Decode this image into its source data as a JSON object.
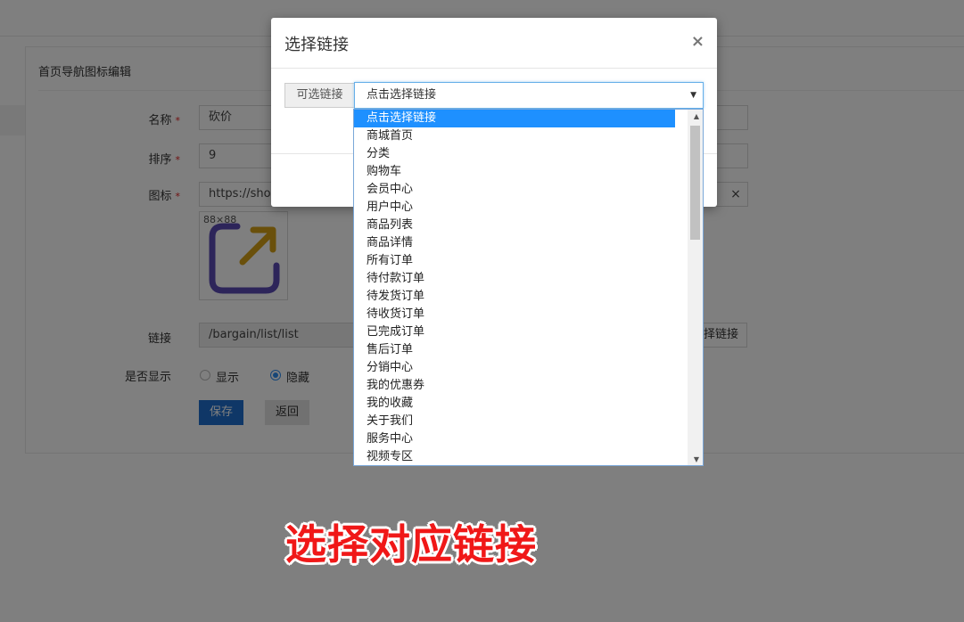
{
  "page": {
    "panel_title": "首页导航图标编辑",
    "fields": {
      "name_label": "名称",
      "name_value": "砍价",
      "sort_label": "排序",
      "sort_value": "9",
      "icon_label": "图标",
      "icon_value": "https://shop",
      "icon_clear": "×",
      "preview_size": "88×88",
      "link_label": "链接",
      "link_value": "/bargain/list/list",
      "link_button": "择链接",
      "show_label": "是否显示",
      "show_option": "显示",
      "hide_option": "隐藏",
      "required_mark": "*"
    },
    "buttons": {
      "save": "保存",
      "back": "返回"
    }
  },
  "modal": {
    "title": "选择链接",
    "close": "×",
    "addon_label": "可选链接",
    "select_value": "点击选择链接",
    "options": [
      "点击选择链接",
      "商城首页",
      "分类",
      "购物车",
      "会员中心",
      "用户中心",
      "商品列表",
      "商品详情",
      "所有订单",
      "待付款订单",
      "待发货订单",
      "待收货订单",
      "已完成订单",
      "售后订单",
      "分销中心",
      "我的优惠券",
      "我的收藏",
      "关于我们",
      "服务中心",
      "视频专区"
    ],
    "selected_index": 0
  },
  "caption": "选择对应链接",
  "colors": {
    "primary": "#1e6ecf",
    "dropdown_highlight": "#1e90ff",
    "caption_red": "#f01818",
    "icon_purple": "#5b4bb5",
    "icon_gold": "#d4a017"
  }
}
